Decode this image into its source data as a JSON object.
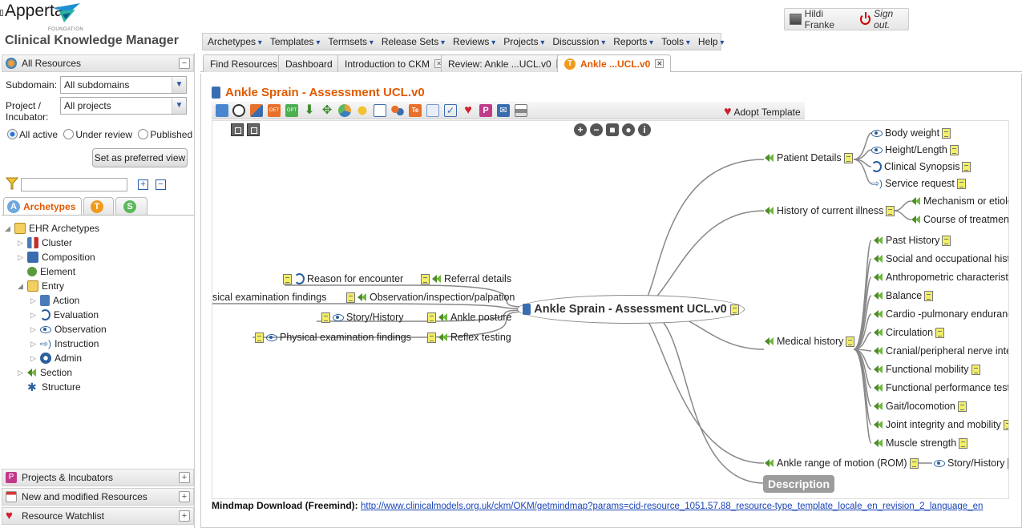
{
  "header": {
    "logo_text": "Apperta",
    "logo_sub": "FOUNDATION",
    "app_title": "Clinical Knowledge Manager",
    "user_name": "Hildi Franke",
    "sign_out": "Sign out."
  },
  "menu": [
    "Archetypes",
    "Templates",
    "Termsets",
    "Release Sets",
    "Reviews",
    "Projects",
    "Discussion",
    "Reports",
    "Tools",
    "Help"
  ],
  "left_panel": {
    "all_resources": "All Resources",
    "subdomain_label": "Subdomain:",
    "subdomain_value": "All subdomains",
    "project_label_1": "Project /",
    "project_label_2": "Incubator:",
    "project_value": "All projects",
    "radios": {
      "all_active": "All active",
      "under_review": "Under review",
      "published": "Published"
    },
    "preferred_view": "Set as preferred view",
    "filter_placeholder": "",
    "tabs": {
      "archetypes": "Archetypes",
      "t_badge": "T",
      "s_badge": "S",
      "a_badge": "A"
    },
    "tree": {
      "root": "EHR Archetypes",
      "cluster": "Cluster",
      "composition": "Composition",
      "element": "Element",
      "entry": "Entry",
      "action": "Action",
      "evaluation": "Evaluation",
      "observation": "Observation",
      "instruction": "Instruction",
      "admin": "Admin",
      "section": "Section",
      "structure": "Structure"
    },
    "bottom": {
      "projects": "Projects & Incubators",
      "new_modified": "New and modified Resources",
      "watchlist": "Resource Watchlist"
    }
  },
  "tabs": [
    {
      "label": "Find Resources"
    },
    {
      "label": "Dashboard"
    },
    {
      "label": "Introduction to CKM"
    },
    {
      "label": "Review: Ankle ...UCL.v0"
    },
    {
      "label": "Ankle ...UCL.v0"
    }
  ],
  "document": {
    "title": "Ankle Sprain - Assessment UCL.v0",
    "adopt": "Adopt Template"
  },
  "mindmap": {
    "centre": "Ankle Sprain - Assessment UCL.v0",
    "right": {
      "patient_details": "Patient Details",
      "body_weight": "Body weight",
      "height_length": "Height/Length",
      "clinical_synopsis": "Clinical Synopsis",
      "service_request": "Service request",
      "history_current": "History of current illness",
      "mechanism": "Mechanism or etiolo",
      "course": "Course of treatment",
      "medical_history": "Medical history",
      "past_history": "Past History",
      "social": "Social and occupational histo",
      "anthropometric": "Anthropometric characteristic",
      "balance": "Balance",
      "cardio": "Cardio -pulmonary enduranc",
      "circulation": "Circulation",
      "cranial": "Cranial/peripheral nerve integ",
      "functional_mobility": "Functional mobility",
      "functional_perf": "Functional performance testin",
      "gait": "Gait/locomotion",
      "joint": "Joint integrity and mobility",
      "muscle": "Muscle strength",
      "rom": "Ankle range of motion (ROM)",
      "story_history_r": "Story/History",
      "description": "Description"
    },
    "left": {
      "referral": "Referral details",
      "reason": "Reason for encounter",
      "obs_insp": "Observation/inspection/palpation",
      "phys_exam_top": "sical examination findings",
      "ankle_posture": "Ankle posture",
      "story_history_l": "Story/History",
      "reflex": "Reflex testing",
      "phys_exam": "Physical examination findings"
    }
  },
  "footer": {
    "label": "Mindmap Download (Freemind):",
    "url": "http://www.clinicalmodels.org.uk/ckm/OKM/getmindmap?params=cid-resource_1051.57.88_resource-type_template_locale_en_revision_2_language_en"
  }
}
